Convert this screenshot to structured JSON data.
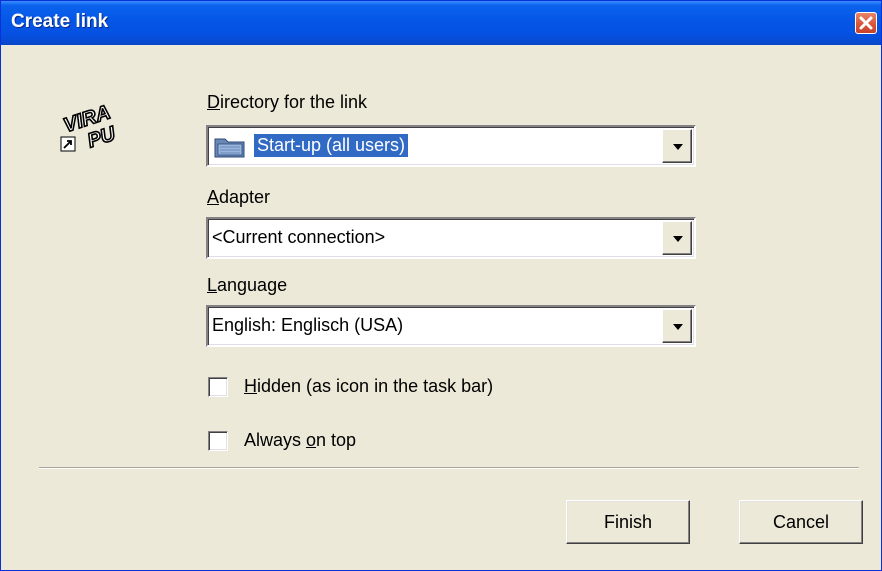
{
  "window": {
    "title": "Create link",
    "close_icon": "close-icon"
  },
  "app_icon": {
    "icon": "vira-pu-shortcut-icon",
    "line1": "VIRA",
    "line2": "PU"
  },
  "directory": {
    "label_u": "D",
    "label_rest": "irectory for the link",
    "value": "Start-up (all users)",
    "value_icon": "folder-icon"
  },
  "adapter": {
    "label_u": "A",
    "label_rest": "dapter",
    "value": "<Current connection>"
  },
  "language": {
    "label_u": "L",
    "label_rest": "anguage",
    "value": "English: Englisch (USA)"
  },
  "options": {
    "hidden": {
      "checked": false,
      "label_u": "H",
      "label_rest": "idden (as icon in the task bar)"
    },
    "always_on_top": {
      "checked": false,
      "label_pre": "Always ",
      "label_u": "o",
      "label_rest": "n top"
    }
  },
  "buttons": {
    "finish": "Finish",
    "cancel": "Cancel"
  },
  "colors": {
    "titlebar": "#0556e6",
    "dialog_bg": "#ece9d8",
    "selection": "#316ac5",
    "close_button": "#d8573a"
  }
}
